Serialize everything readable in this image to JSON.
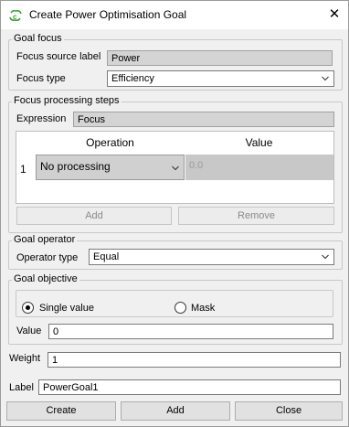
{
  "window": {
    "title": "Create Power Optimisation Goal",
    "close_glyph": "✕"
  },
  "goal_focus": {
    "group_label": "Goal focus",
    "source_label": "Focus source label",
    "source_value": "Power",
    "type_label": "Focus type",
    "type_value": "Efficiency"
  },
  "processing": {
    "group_label": "Focus processing steps",
    "expression_label": "Expression",
    "expression_value": "Focus",
    "columns": [
      "Operation",
      "Value"
    ],
    "rows": [
      {
        "index": "1",
        "operation": "No processing",
        "value": "0.0"
      }
    ],
    "add_label": "Add",
    "remove_label": "Remove"
  },
  "operator": {
    "group_label": "Goal operator",
    "type_label": "Operator type",
    "type_value": "Equal"
  },
  "objective": {
    "group_label": "Goal objective",
    "single_label": "Single value",
    "mask_label": "Mask",
    "selected": "single",
    "value_label": "Value",
    "value": "0"
  },
  "weight": {
    "label": "Weight",
    "value": "1"
  },
  "label_field": {
    "label": "Label",
    "value": "PowerGoal1"
  },
  "footer": {
    "create": "Create",
    "add": "Add",
    "close": "Close"
  },
  "colors": {
    "icon_green": "#3b9e3b",
    "group_border": "#c8c8c8",
    "readonly_bg": "#d4d4d4"
  }
}
